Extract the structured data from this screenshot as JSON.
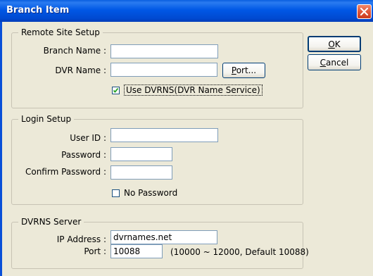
{
  "window": {
    "title": "Branch Item",
    "close_icon": "close-x-icon",
    "accent_color": "#0058e6",
    "close_color": "#e0573a"
  },
  "buttons": {
    "ok_label": "OK",
    "ok_mnemonic": "O",
    "ok_rest": "K",
    "cancel_label": "Cancel",
    "cancel_mnemonic": "C",
    "cancel_rest": "ancel"
  },
  "remote_site": {
    "legend": "Remote Site Setup",
    "branch_name_label": "Branch Name :",
    "branch_name_value": "",
    "dvr_name_label": "DVR Name :",
    "dvr_name_value": "",
    "port_button_label": "Port...",
    "port_mnemonic": "P",
    "port_rest": "ort...",
    "use_dvrns_label": "Use DVRNS(DVR Name Service)",
    "use_dvrns_checked": true
  },
  "login": {
    "legend": "Login Setup",
    "user_id_label": "User ID :",
    "user_id_value": "",
    "password_label": "Password :",
    "password_value": "",
    "confirm_password_label": "Confirm Password :",
    "confirm_password_value": "",
    "no_password_label": "No Password",
    "no_password_checked": false
  },
  "dvrns_server": {
    "legend": "DVRNS Server",
    "ip_address_label": "IP Address :",
    "ip_address_value": "dvrnames.net",
    "port_label": "Port :",
    "port_value": "10088",
    "port_hint": "(10000 ~ 12000, Default 10088)"
  }
}
